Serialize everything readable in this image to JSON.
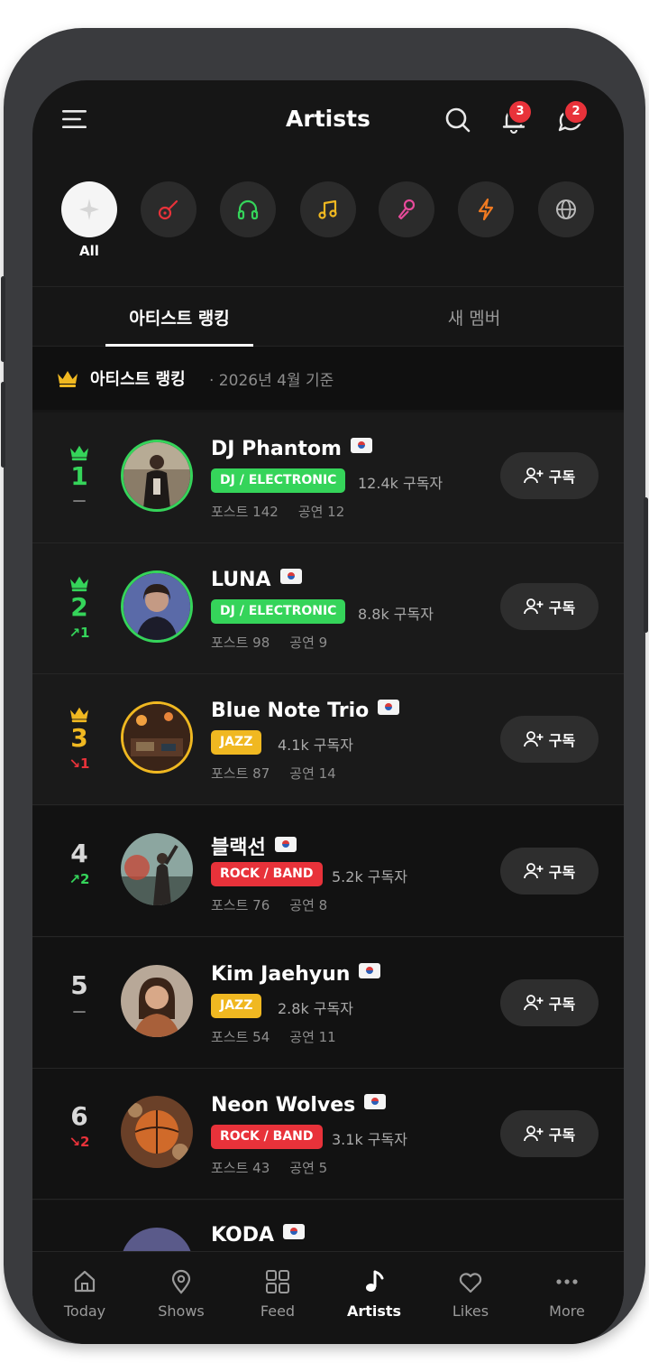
{
  "header": {
    "title": "Artists",
    "notifications_badge": "3",
    "messages_badge": "2"
  },
  "categories": [
    {
      "icon": "sparkle-icon",
      "label": "All",
      "color": "#ffffff",
      "active": true
    },
    {
      "icon": "guitar-icon",
      "color": "#e8323a"
    },
    {
      "icon": "headphones-icon",
      "color": "#35d45a"
    },
    {
      "icon": "music-note-icon",
      "color": "#f0b821"
    },
    {
      "icon": "microphone-icon",
      "color": "#e64a9a"
    },
    {
      "icon": "lightning-icon",
      "color": "#f07a21"
    },
    {
      "icon": "globe-icon",
      "color": "#bbbbbb"
    }
  ],
  "tabs": [
    {
      "label": "아티스트 랭킹",
      "active": true
    },
    {
      "label": "새 멤버",
      "active": false
    }
  ],
  "section": {
    "title": "아티스트 랭킹",
    "subtitle": "· 2026년 4월 기준"
  },
  "artists": [
    {
      "rank": "1",
      "trend": "—",
      "trend_dir": "flat",
      "name": "DJ Phantom",
      "genre": "DJ / ELECTRONIC",
      "subscribers": "12.4k 구독자",
      "posts": "포스트 142",
      "shows": "공연 12",
      "button": "구독"
    },
    {
      "rank": "2",
      "trend": "↗1",
      "trend_dir": "up",
      "name": "LUNA",
      "genre": "DJ / ELECTRONIC",
      "subscribers": "8.8k 구독자",
      "posts": "포스트 98",
      "shows": "공연 9",
      "button": "구독"
    },
    {
      "rank": "3",
      "trend": "↘1",
      "trend_dir": "down",
      "name": "Blue Note Trio",
      "genre": "JAZZ",
      "subscribers": "4.1k 구독자",
      "posts": "포스트 87",
      "shows": "공연 14",
      "button": "구독"
    },
    {
      "rank": "4",
      "trend": "↗2",
      "trend_dir": "up",
      "name": "블랙선",
      "genre": "ROCK / BAND",
      "subscribers": "5.2k 구독자",
      "posts": "포스트 76",
      "shows": "공연 8",
      "button": "구독"
    },
    {
      "rank": "5",
      "trend": "—",
      "trend_dir": "flat",
      "name": "Kim Jaehyun",
      "genre": "JAZZ",
      "subscribers": "2.8k 구독자",
      "posts": "포스트 54",
      "shows": "공연 11",
      "button": "구독"
    },
    {
      "rank": "6",
      "trend": "↘2",
      "trend_dir": "down",
      "name": "Neon Wolves",
      "genre": "ROCK / BAND",
      "subscribers": "3.1k 구독자",
      "posts": "포스트 43",
      "shows": "공연 5",
      "button": "구독"
    },
    {
      "name": "KODA"
    }
  ],
  "nav": [
    {
      "label": "Today",
      "icon": "home-icon"
    },
    {
      "label": "Shows",
      "icon": "map-pin-icon"
    },
    {
      "label": "Feed",
      "icon": "grid-icon"
    },
    {
      "label": "Artists",
      "icon": "music-note-icon",
      "active": true
    },
    {
      "label": "Likes",
      "icon": "heart-icon"
    },
    {
      "label": "More",
      "icon": "more-dots-icon"
    }
  ],
  "colors": {
    "accent_green": "#35d45a",
    "accent_gold": "#f0b821",
    "accent_red": "#e8323a",
    "background": "#161616"
  }
}
